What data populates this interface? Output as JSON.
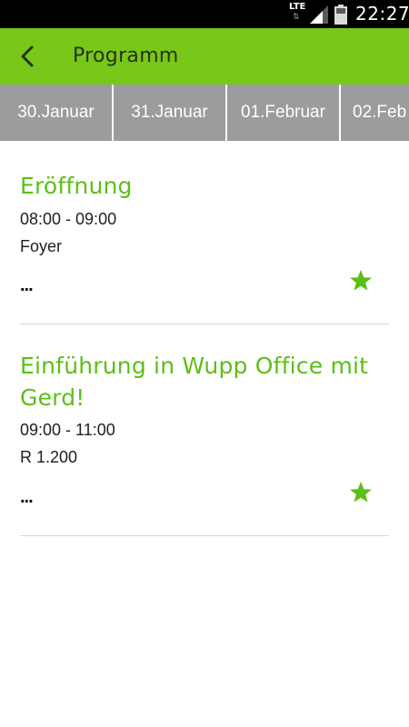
{
  "status_bar": {
    "network": "LTE",
    "network_arrows": "⇅",
    "time": "22:27"
  },
  "app_bar": {
    "back_icon": "chevron-left-icon",
    "title": "Programm"
  },
  "date_tabs": [
    {
      "label": "30.Januar"
    },
    {
      "label": "31.Januar"
    },
    {
      "label": "01.Februar"
    },
    {
      "label": "02.Feb"
    }
  ],
  "events": [
    {
      "title": "Eröffnung",
      "time": "08:00 - 09:00",
      "room": "Foyer",
      "more": "...",
      "star_icon": "star-icon"
    },
    {
      "title": "Einführung in Wupp Office mit Gerd!",
      "time": "09:00 - 11:00",
      "room": "R 1.200",
      "more": "...",
      "star_icon": "star-icon"
    }
  ],
  "colors": {
    "app_bar": "#78c719",
    "title_text": "#5cbf16",
    "tabs_bg": "#9c9c9c",
    "star": "#5cbf16"
  }
}
